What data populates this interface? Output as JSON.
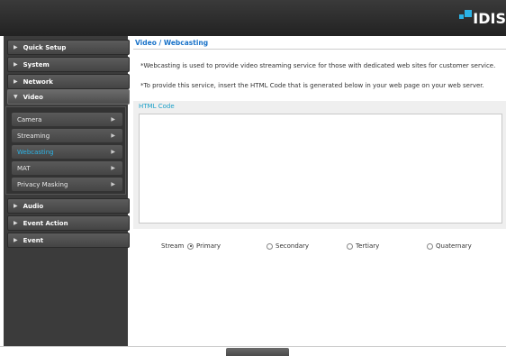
{
  "brand": {
    "logo_text": "IDIS",
    "accent": "#2bb3e6"
  },
  "sidebar": {
    "main_items": [
      {
        "label": "Quick Setup"
      },
      {
        "label": "System"
      },
      {
        "label": "Network"
      },
      {
        "label": "Video"
      },
      {
        "label": "Audio"
      },
      {
        "label": "Event Action"
      },
      {
        "label": "Event"
      }
    ],
    "video_submenu": [
      {
        "label": "Camera"
      },
      {
        "label": "Streaming"
      },
      {
        "label": "Webcasting"
      },
      {
        "label": "MAT"
      },
      {
        "label": "Privacy Masking"
      }
    ],
    "selected_submenu": "Webcasting"
  },
  "main": {
    "title": "Video / Webcasting",
    "paragraphs": [
      "*Webcasting is used to provide video streaming service for those with dedicated web sites for customer service.",
      "*To provide this service, insert the HTML Code that is generated below in your web page on your web server."
    ],
    "html_code_label": "HTML Code",
    "html_code_value": "",
    "stream": {
      "label": "Stream",
      "options": [
        "Primary",
        "Secondary",
        "Tertiary",
        "Quaternary"
      ],
      "selected": "Primary"
    }
  }
}
